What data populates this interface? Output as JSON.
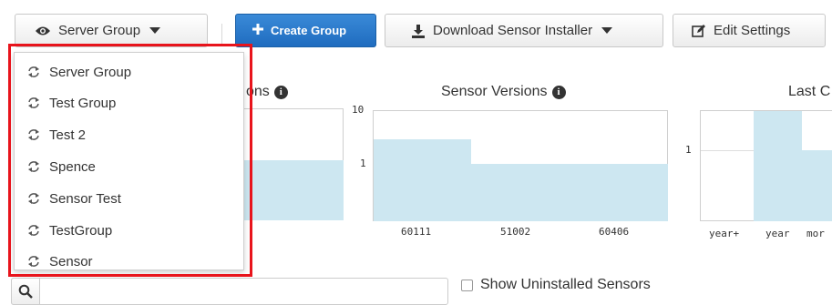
{
  "toolbar": {
    "group_select": {
      "label": "Server Group",
      "icon": "eye-icon"
    },
    "create_group": {
      "label": "Create Group",
      "icon": "plus-icon"
    },
    "download_installer": {
      "label": "Download Sensor Installer",
      "icon": "download-icon"
    },
    "edit_settings": {
      "label": "Edit Settings",
      "icon": "edit-icon"
    }
  },
  "group_dropdown": {
    "items": [
      {
        "label": "Server Group"
      },
      {
        "label": "Test Group"
      },
      {
        "label": "Test 2"
      },
      {
        "label": "Spence"
      },
      {
        "label": "Sensor Test"
      },
      {
        "label": "TestGroup"
      },
      {
        "label": "Sensor"
      }
    ],
    "highlight_color": "#e8141c"
  },
  "charts": {
    "left_partial_title": "ons",
    "sensor_versions_title": "Sensor Versions",
    "last_partial_title": "Last C",
    "bar_color": "#cde7f1"
  },
  "chart_data": [
    {
      "type": "bar",
      "title": "Sensor Versions",
      "categories": [
        "60111",
        "51002",
        "60406"
      ],
      "values": [
        2.5,
        1.6,
        1.6
      ],
      "yscale": "log",
      "yticks": [
        "10",
        "1"
      ],
      "ylim": [
        0.1,
        10
      ]
    },
    {
      "type": "bar",
      "title": "Last C",
      "categories": [
        "year+",
        "year",
        "mor"
      ],
      "values": [
        0,
        6.5,
        2.5
      ],
      "yscale": "log",
      "yticks": [
        "1"
      ]
    }
  ],
  "filters": {
    "search_placeholder": "",
    "show_uninstalled_label": "Show Uninstalled Sensors",
    "show_uninstalled_checked": false
  }
}
